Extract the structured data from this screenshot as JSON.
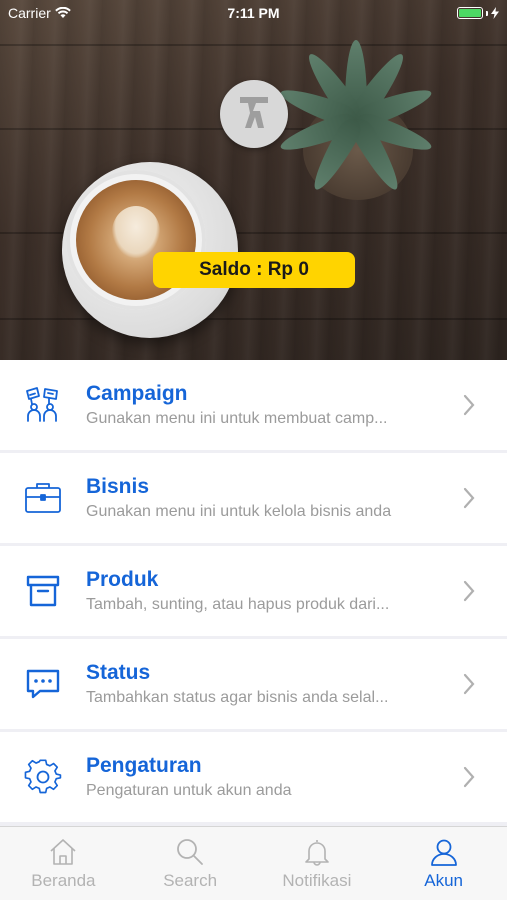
{
  "status_bar": {
    "carrier": "Carrier",
    "time": "7:11 PM",
    "battery_color": "#4cd964"
  },
  "header": {
    "avatar_icon": "yellow-pages-walking-fingers-icon",
    "saldo_label": "Saldo : Rp 0",
    "saldo_color": "#ffd400"
  },
  "menu": {
    "items": [
      {
        "icon": "campaign-megaphone-icon",
        "title": "Campaign",
        "desc": "Gunakan menu ini untuk membuat camp..."
      },
      {
        "icon": "briefcase-icon",
        "title": "Bisnis",
        "desc": "Gunakan menu ini untuk kelola bisnis anda"
      },
      {
        "icon": "archive-box-icon",
        "title": "Produk",
        "desc": "Tambah, sunting, atau hapus produk dari..."
      },
      {
        "icon": "chat-bubble-icon",
        "title": "Status",
        "desc": "Tambahkan status agar bisnis anda selal..."
      },
      {
        "icon": "gear-icon",
        "title": "Pengaturan",
        "desc": "Pengaturan untuk akun anda"
      }
    ],
    "accent_color": "#1565d8"
  },
  "tabbar": {
    "tabs": [
      {
        "icon": "home-icon",
        "label": "Beranda",
        "active": false
      },
      {
        "icon": "search-icon",
        "label": "Search",
        "active": false
      },
      {
        "icon": "bell-icon",
        "label": "Notifikasi",
        "active": false
      },
      {
        "icon": "user-icon",
        "label": "Akun",
        "active": true
      }
    ]
  }
}
